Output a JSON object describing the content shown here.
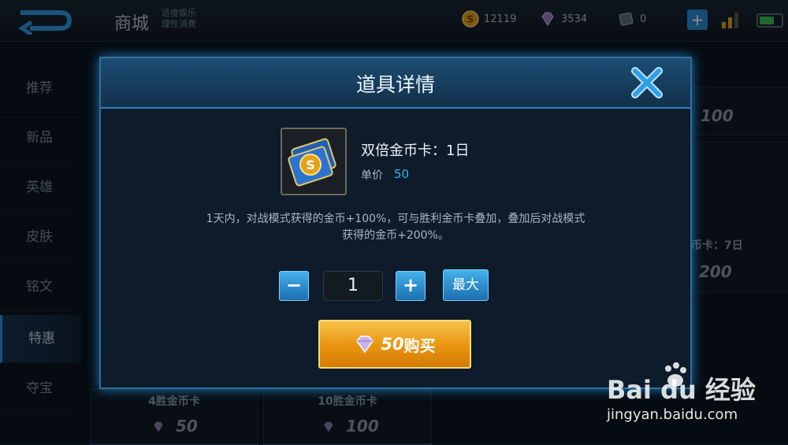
{
  "header": {
    "title": "商城",
    "subtitle_line1": "适度娱乐",
    "subtitle_line2": "理性消费",
    "gold": "12119",
    "diamonds": "3534",
    "vouchers": "0",
    "plus": "+",
    "battery_level": 0.7
  },
  "sidebar": {
    "items": [
      {
        "label": "推荐"
      },
      {
        "label": "新品"
      },
      {
        "label": "英雄"
      },
      {
        "label": "皮肤"
      },
      {
        "label": "铭文"
      },
      {
        "label": "特惠"
      },
      {
        "label": "夺宝"
      }
    ],
    "active_index": 5
  },
  "background_cards": {
    "top_right_price": "100",
    "mid_right_name": "币卡：7日",
    "mid_right_price": "200",
    "bottom_left_name": "4胜金币卡",
    "bottom_left_price": "50",
    "bottom_mid_name": "10胜金币卡",
    "bottom_mid_price": "100"
  },
  "dialog": {
    "title": "道具详情",
    "item_name": "双倍金币卡：1日",
    "price_label": "单价",
    "price_value": "50",
    "description_line1": "1天内，对战模式获得的金币+100%，可与胜利金币卡叠加，叠加后对战模式",
    "description_line2": "获得的金币+200%。",
    "minus_label": "−",
    "quantity": "1",
    "plus_label": "+",
    "max_label": "最大",
    "buy_price": "50",
    "buy_label": "购买"
  },
  "watermark": {
    "logo_text": "Bai du 经验",
    "url": "jingyan.baidu.com"
  },
  "colors": {
    "accent_blue": "#2c96e2",
    "price_blue": "#36b4ee",
    "buy_gold": "#e8940f"
  }
}
